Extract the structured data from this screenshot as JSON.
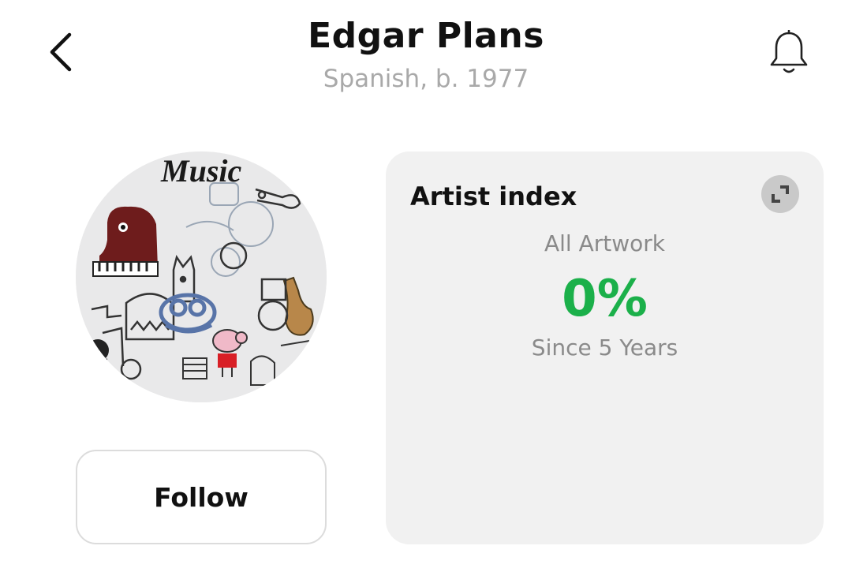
{
  "header": {
    "title": "Edgar Plans",
    "subtitle": "Spanish, b. 1977",
    "back_icon": "chevron-left-icon",
    "notify_icon": "bell-icon"
  },
  "artist": {
    "avatar_icon": "artwork-thumbnail",
    "artwork_text": "Music",
    "follow_label": "Follow"
  },
  "index_card": {
    "title": "Artist index",
    "expand_icon": "expand-icon",
    "label": "All Artwork",
    "value": "0%",
    "period": "Since 5 Years"
  },
  "colors": {
    "positive": "#1bb04a",
    "card_bg": "#f1f1f1",
    "muted_text": "#8a8a8a"
  }
}
